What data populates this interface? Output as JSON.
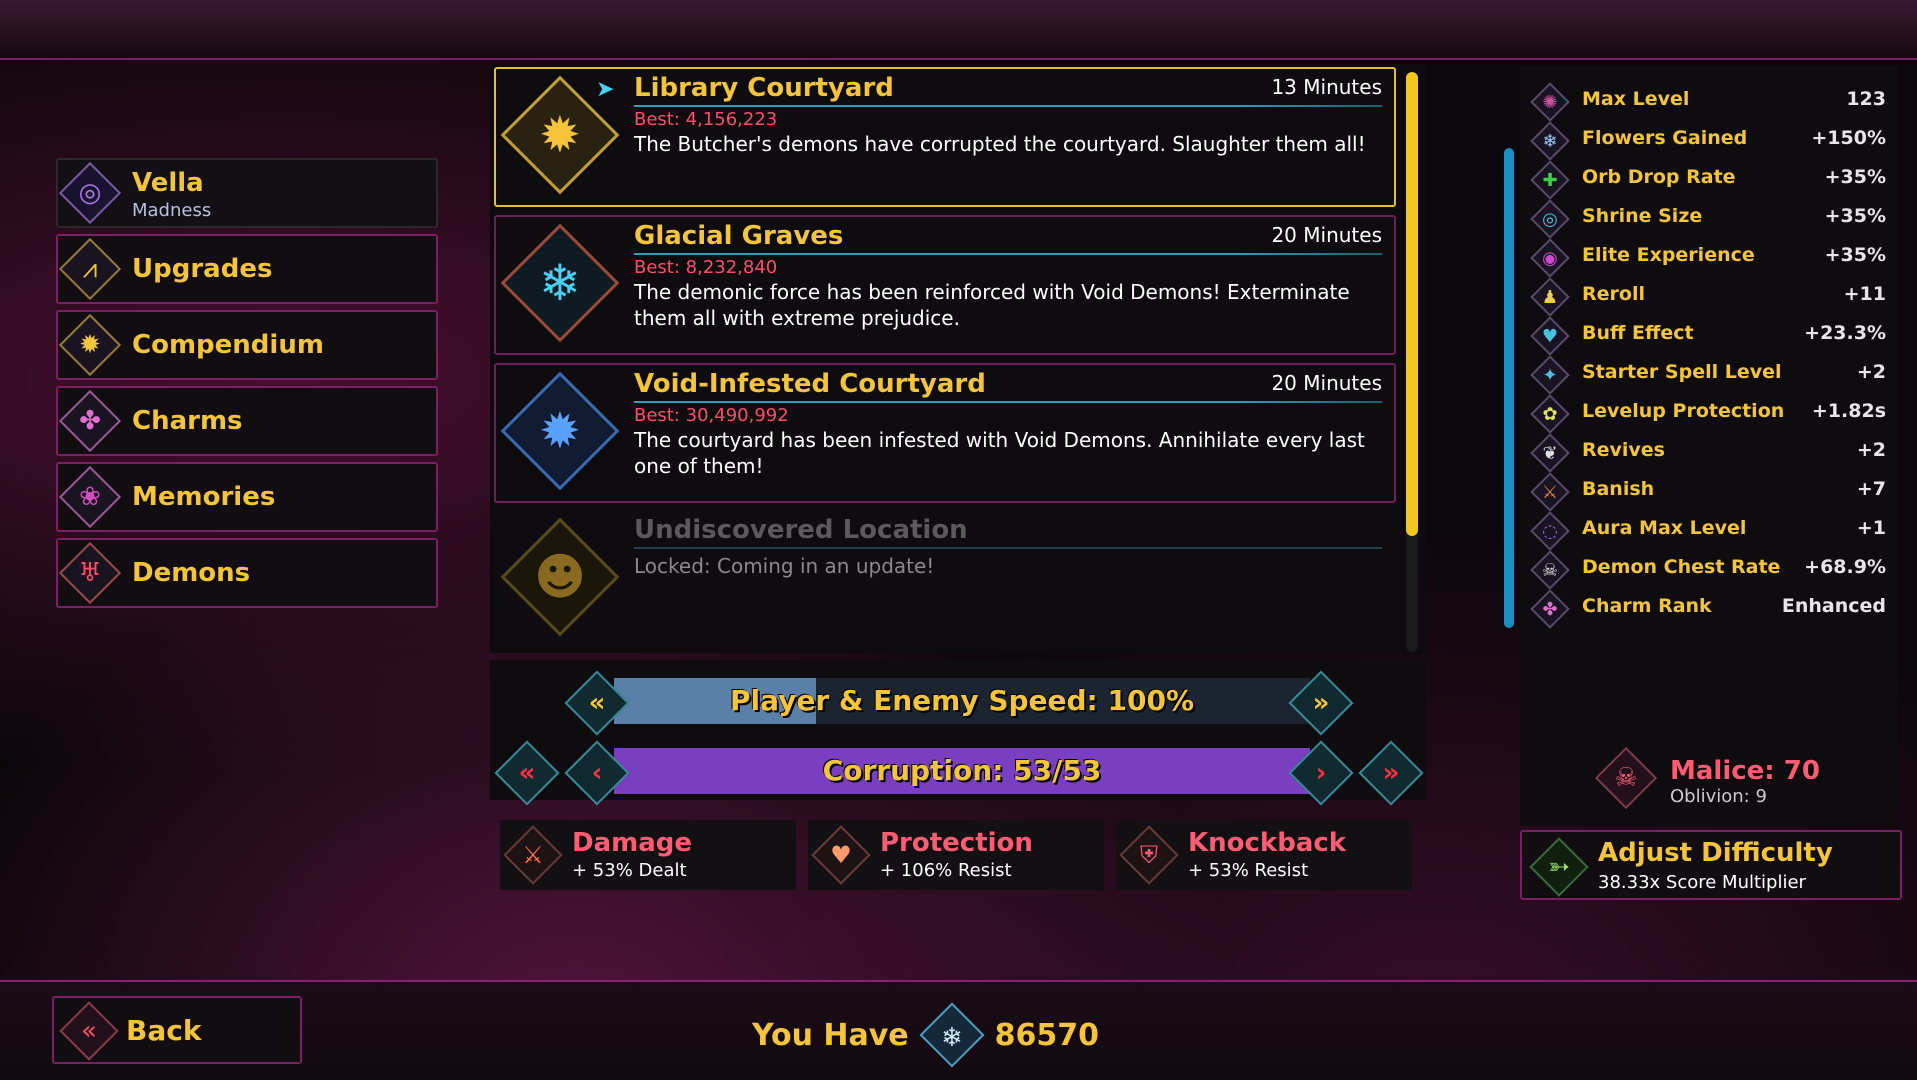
{
  "menu": {
    "vella": {
      "label": "Vella",
      "sub": "Madness",
      "icon": "vella-icon"
    },
    "items": [
      {
        "label": "Upgrades",
        "icon": "upgrades-icon",
        "glyph": "⩘"
      },
      {
        "label": "Compendium",
        "icon": "book-icon",
        "glyph": "✹"
      },
      {
        "label": "Charms",
        "icon": "charm-icon",
        "glyph": "✤"
      },
      {
        "label": "Memories",
        "icon": "brain-icon",
        "glyph": "❀"
      },
      {
        "label": "Demons",
        "icon": "demon-icon",
        "glyph": "♅"
      }
    ]
  },
  "locations": [
    {
      "title": "Library Courtyard",
      "time": "13 Minutes",
      "best": "Best: 4,156,223",
      "desc": "The Butcher's demons have corrupted the courtyard. Slaughter them all!"
    },
    {
      "title": "Glacial Graves",
      "time": "20 Minutes",
      "best": "Best: 8,232,840",
      "desc": "The demonic force has been reinforced with Void Demons! Exterminate them all with extreme prejudice."
    },
    {
      "title": "Void-Infested Courtyard",
      "time": "20 Minutes",
      "best": "Best: 30,490,992",
      "desc": "The courtyard has been infested with Void Demons. Annihilate every last one of them!"
    },
    {
      "title": "Undiscovered Location",
      "desc": "Locked: Coming in an update!"
    }
  ],
  "speed": {
    "label": "Player & Enemy Speed: 100%",
    "fill": 0.29
  },
  "corruption": {
    "label": "Corruption: 53/53",
    "fill": 1.0
  },
  "stats": [
    {
      "name": "Damage",
      "value": "+ 53% Dealt"
    },
    {
      "name": "Protection",
      "value": "+ 106% Resist"
    },
    {
      "name": "Knockback",
      "value": "+ 53% Resist"
    }
  ],
  "modifiers": [
    {
      "name": "Max Level",
      "value": "123",
      "glyph": "✺",
      "color": "#d050a0"
    },
    {
      "name": "Flowers Gained",
      "value": "+150%",
      "glyph": "❄",
      "color": "#9ac8ff"
    },
    {
      "name": "Orb Drop Rate",
      "value": "+35%",
      "glyph": "✚",
      "color": "#3ad04a"
    },
    {
      "name": "Shrine Size",
      "value": "+35%",
      "glyph": "◎",
      "color": "#4ac0e0"
    },
    {
      "name": "Elite Experience",
      "value": "+35%",
      "glyph": "◉",
      "color": "#d04ad0"
    },
    {
      "name": "Reroll",
      "value": "+11",
      "glyph": "♟",
      "color": "#f0d040"
    },
    {
      "name": "Buff Effect",
      "value": "+23.3%",
      "glyph": "♥",
      "color": "#4ac0e0"
    },
    {
      "name": "Starter Spell Level",
      "value": "+2",
      "glyph": "✦",
      "color": "#4ac0e0"
    },
    {
      "name": "Levelup Protection",
      "value": "+1.82s",
      "glyph": "✿",
      "color": "#e0e060"
    },
    {
      "name": "Revives",
      "value": "+2",
      "glyph": "❦",
      "color": "#e0e0e0"
    },
    {
      "name": "Banish",
      "value": "+7",
      "glyph": "⚔",
      "color": "#e08040"
    },
    {
      "name": "Aura Max Level",
      "value": "+1",
      "glyph": "◌",
      "color": "#a060e0"
    },
    {
      "name": "Demon Chest Rate",
      "value": "+68.9%",
      "glyph": "☠",
      "color": "#e0e0e0"
    },
    {
      "name": "Charm Rank",
      "value": "Enhanced",
      "glyph": "✤",
      "color": "#e070d0"
    }
  ],
  "malice": {
    "title": "Malice: 70",
    "oblivion": "Oblivion: 9"
  },
  "adjust": {
    "title": "Adjust Difficulty",
    "sub": "38.33x Score Multiplier"
  },
  "back": {
    "label": "Back"
  },
  "currency": {
    "label": "You Have",
    "amount": "86570"
  }
}
